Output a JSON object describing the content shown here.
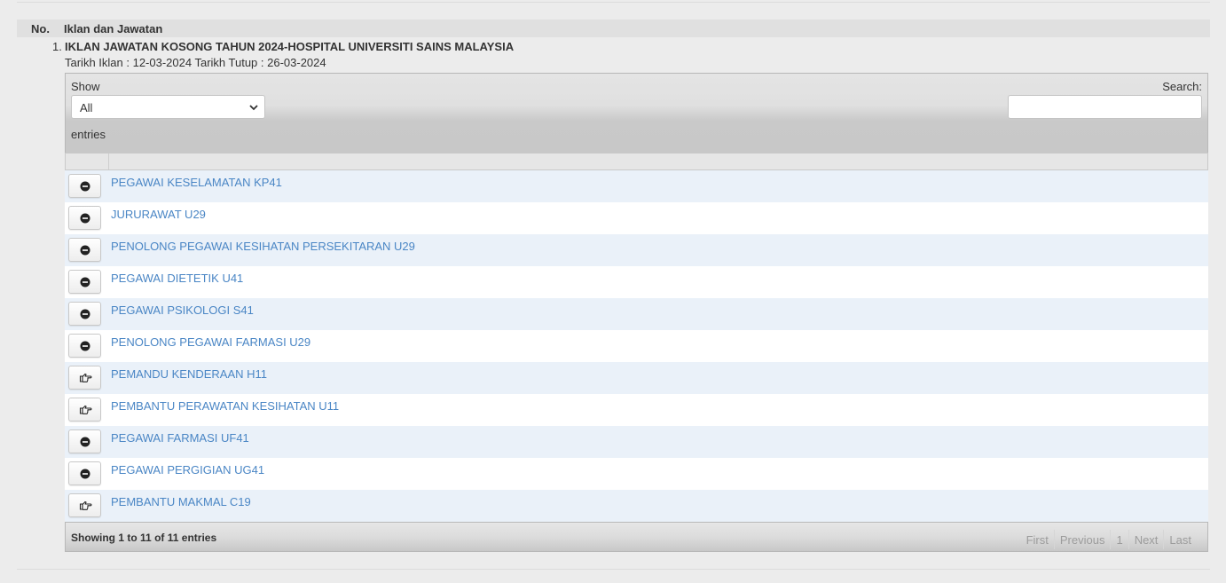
{
  "header": {
    "no_label": "No.",
    "title_label": "Iklan dan Jawatan"
  },
  "item": {
    "number": "1.",
    "title": "IKLAN JAWATAN KOSONG TAHUN 2024-HOSPITAL UNIVERSITI SAINS MALAYSIA",
    "dates": "Tarikh Iklan : 12-03-2024 Tarikh Tutup : 26-03-2024"
  },
  "table": {
    "show_label": "Show",
    "length_value": "All",
    "entries_label": "entries",
    "search_label": "Search:",
    "search_value": "",
    "rows": [
      {
        "title": "PEGAWAI KESELAMATAN KP41",
        "icon": "minus-circle-icon"
      },
      {
        "title": "JURURAWAT U29",
        "icon": "minus-circle-icon"
      },
      {
        "title": "PENOLONG PEGAWAI KESIHATAN PERSEKITARAN U29",
        "icon": "minus-circle-icon"
      },
      {
        "title": "PEGAWAI DIETETIK U41",
        "icon": "minus-circle-icon"
      },
      {
        "title": "PEGAWAI PSIKOLOGI S41",
        "icon": "minus-circle-icon"
      },
      {
        "title": "PENOLONG PEGAWAI FARMASI U29",
        "icon": "minus-circle-icon"
      },
      {
        "title": "PEMANDU KENDERAAN H11",
        "icon": "hand-point-right-icon"
      },
      {
        "title": "PEMBANTU PERAWATAN KESIHATAN U11",
        "icon": "hand-point-right-icon"
      },
      {
        "title": "PEGAWAI FARMASI UF41",
        "icon": "minus-circle-icon"
      },
      {
        "title": "PEGAWAI PERGIGIAN UG41",
        "icon": "minus-circle-icon"
      },
      {
        "title": "PEMBANTU MAKMAL C19",
        "icon": "hand-point-right-icon"
      }
    ],
    "info": {
      "prefix": "Showing",
      "start": "1",
      "to": "to",
      "end": "11",
      "of": "of",
      "total": "11",
      "suffix": "entries"
    },
    "pager": {
      "first": "First",
      "previous": "Previous",
      "page": "1",
      "next": "Next",
      "last": "Last"
    }
  },
  "colors": {
    "link": "#4a86c5",
    "row_odd": "#eaf1f9",
    "row_even": "#ffffff"
  }
}
